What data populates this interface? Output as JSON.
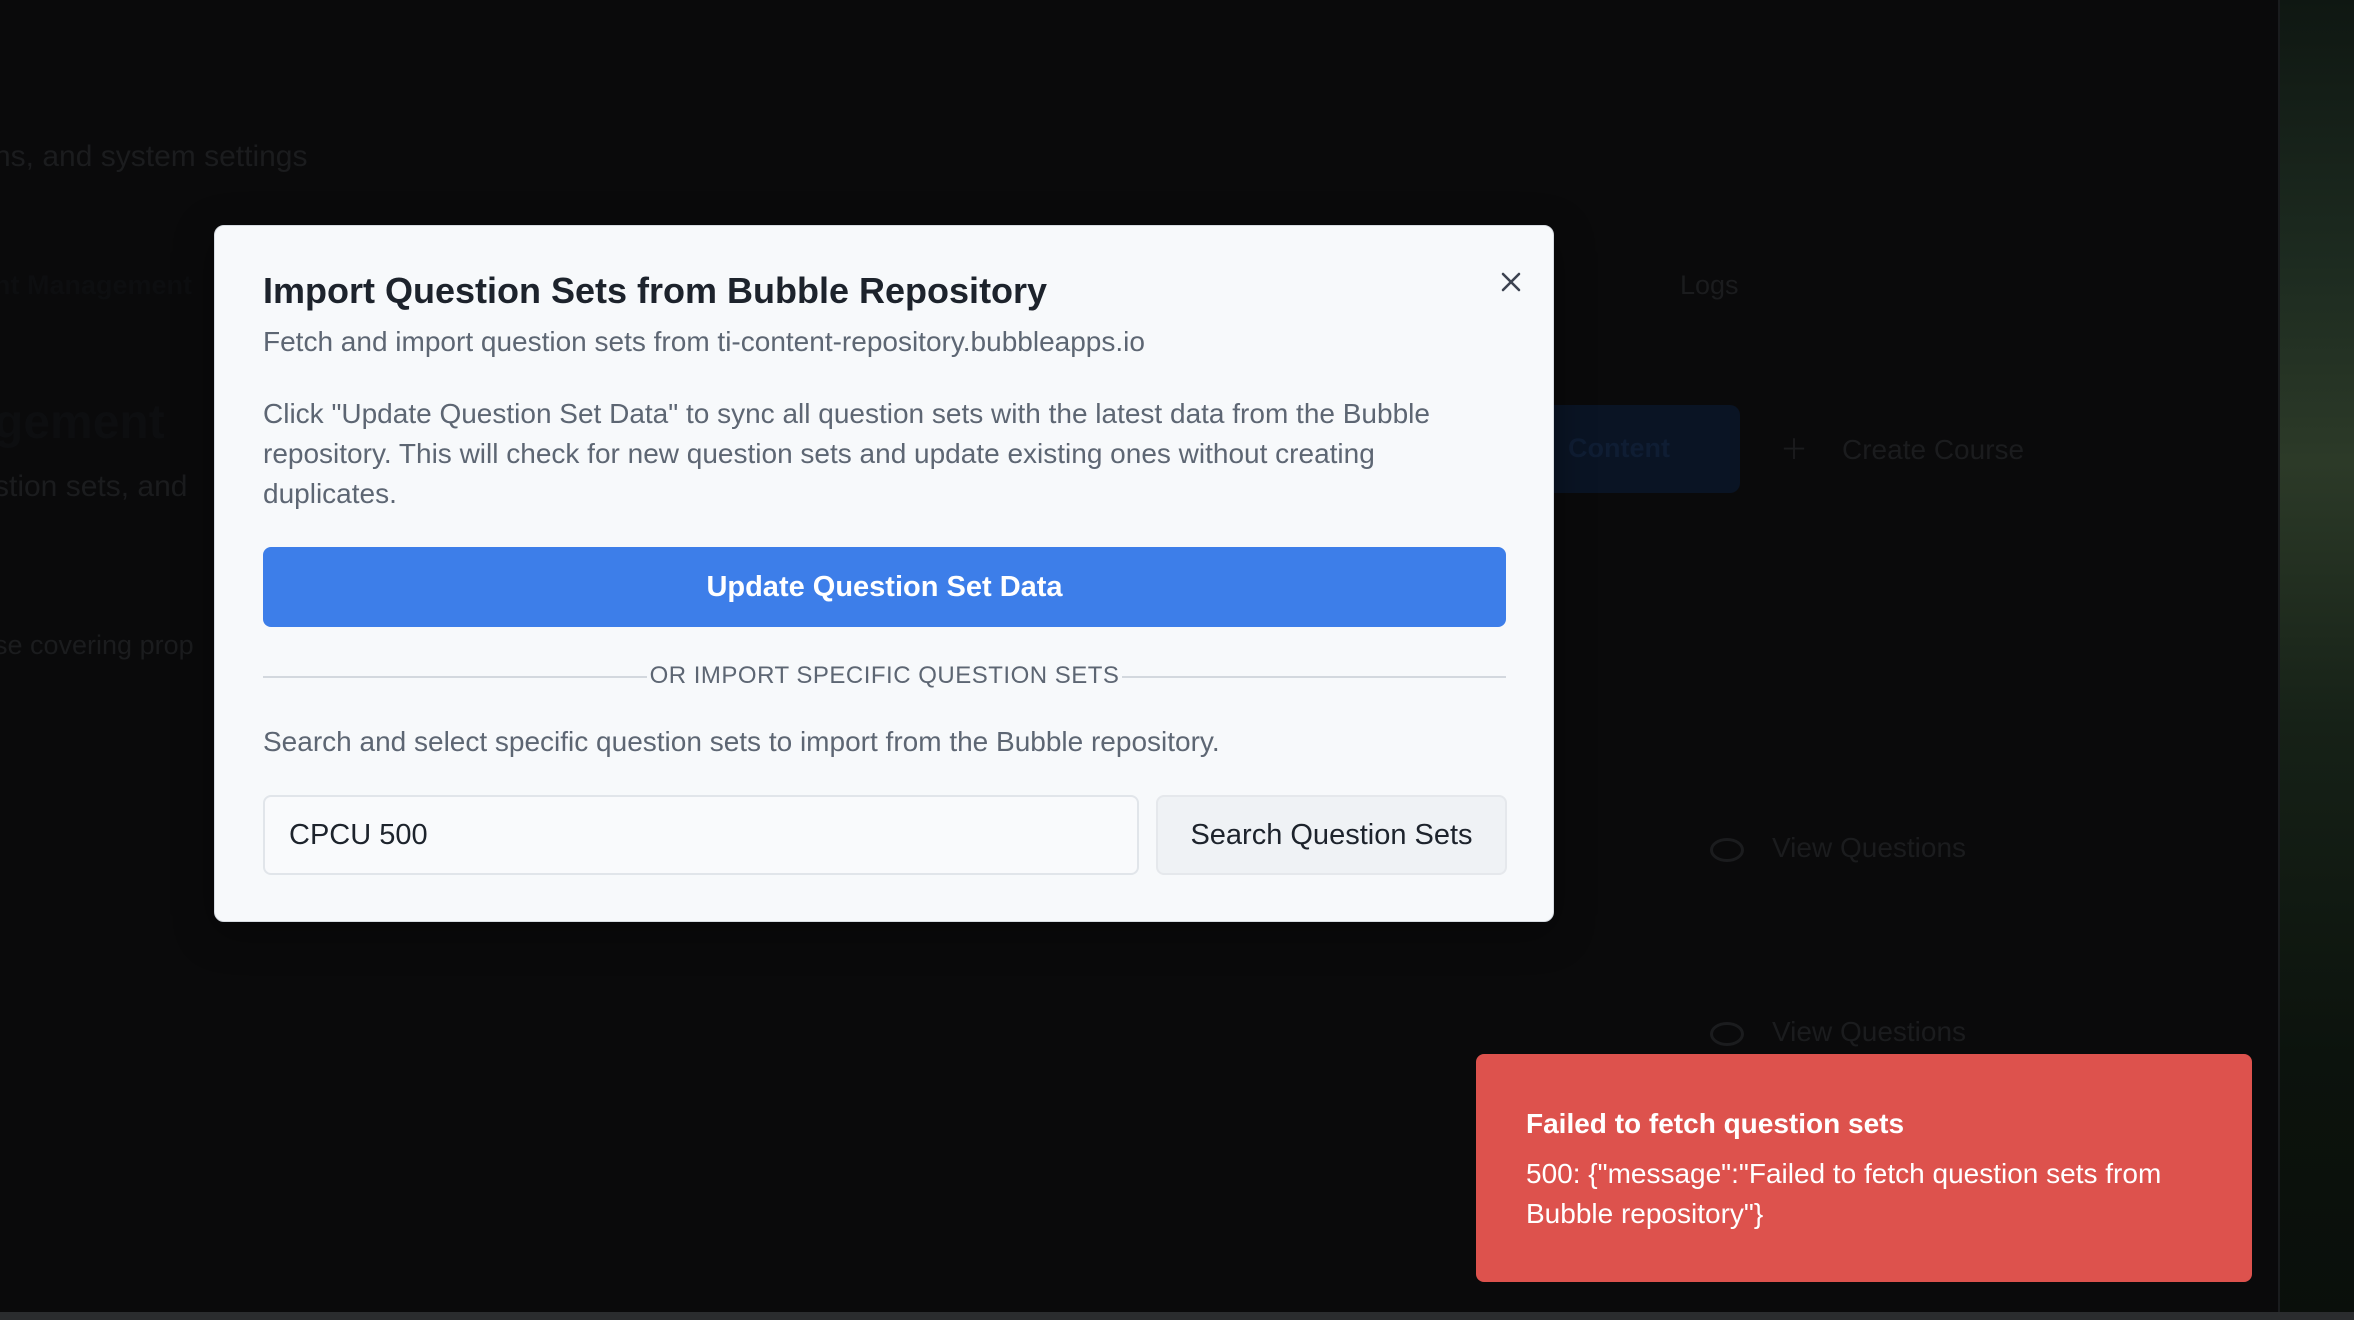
{
  "background": {
    "subtitle_fragment": "ns, and system settings",
    "tab_active_fragment": "nt Management",
    "tab_logs": "Logs",
    "heading_fragment": "gement",
    "description_fragment": "stion sets, and",
    "covering_fragment": "se covering prop",
    "dark_button_fragment": "Content",
    "create_course_label": "Create Course",
    "view_questions_labels": [
      "View Questions",
      "View Questions"
    ]
  },
  "modal": {
    "title": "Import Question Sets from Bubble Repository",
    "description": "Fetch and import question sets from ti-content-repository.bubbleapps.io",
    "info": "Click \"Update Question Set Data\" to sync all question sets with the latest data from the Bubble repository. This will check for new question sets and update existing ones without creating duplicates.",
    "update_button_label": "Update Question Set Data",
    "divider_label": "OR IMPORT SPECIFIC QUESTION SETS",
    "search_help": "Search and select specific question sets to import from the Bubble repository.",
    "search_value": "CPCU 500",
    "search_button_label": "Search Question Sets",
    "close_icon": "close-icon"
  },
  "toast": {
    "title": "Failed to fetch question sets",
    "message": "500: {\"message\":\"Failed to fetch question sets from Bubble repository\"}",
    "color": "#dd524d"
  },
  "colors": {
    "primary": "#3d7ee9",
    "error": "#dd524d",
    "modal_bg": "#f7f9fb"
  }
}
